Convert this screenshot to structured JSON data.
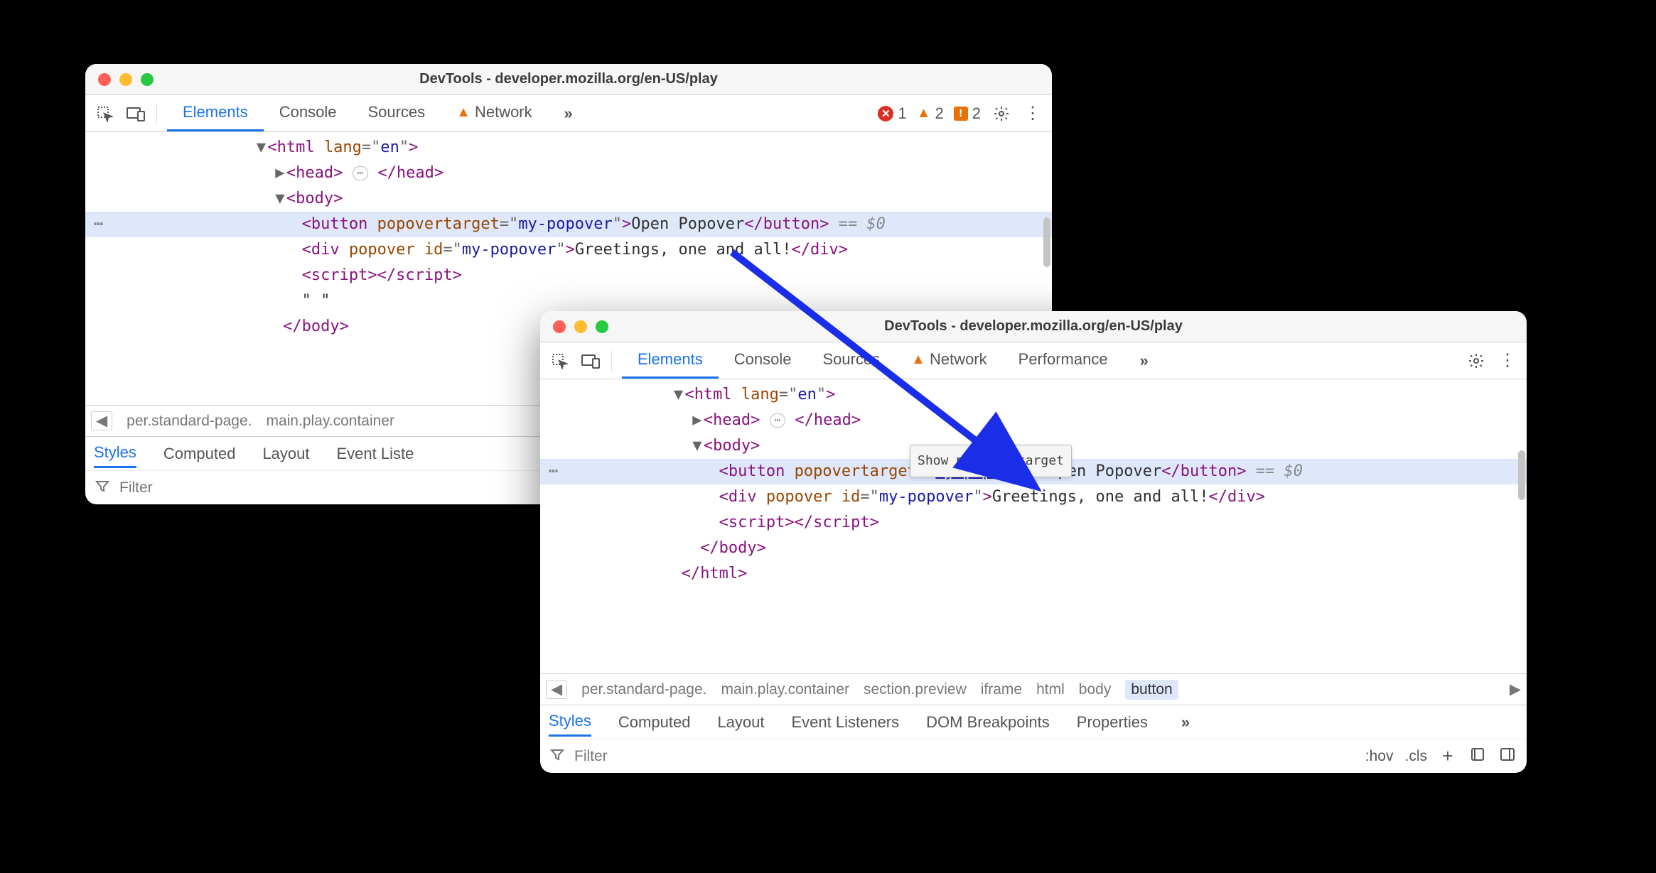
{
  "window1": {
    "title": "DevTools - developer.mozilla.org/en-US/play",
    "tabs": [
      "Elements",
      "Console",
      "Sources",
      "Network"
    ],
    "active_tab": "Elements",
    "network_has_warning": true,
    "counts": {
      "errors": "1",
      "warnings": "2",
      "issues": "2"
    },
    "dom": {
      "html_open": "<html lang=\"en\">",
      "head": {
        "open": "<head>",
        "close": "</head>"
      },
      "body_open": "<body>",
      "button": {
        "tag_open": "<button",
        "attr_name": "popovertarget",
        "attr_val": "my-popover",
        "text": "Open Popover",
        "tag_close": "</button>",
        "eq": " == $0"
      },
      "div": {
        "tag_open": "<div",
        "attr1": "popover",
        "attr2_name": "id",
        "attr2_val": "my-popover",
        "text": "Greetings, one and all!",
        "tag_close": "</div>"
      },
      "script": {
        "open": "<script>",
        "close": "</script>"
      },
      "quote_row": "\" \"",
      "body_close": "</body>"
    },
    "crumbs": [
      "per.standard-page.",
      "main.play.container"
    ],
    "subtabs": [
      "Styles",
      "Computed",
      "Layout",
      "Event Liste"
    ],
    "active_subtab": "Styles",
    "filter_placeholder": "Filter"
  },
  "window2": {
    "title": "DevTools - developer.mozilla.org/en-US/play",
    "tabs": [
      "Elements",
      "Console",
      "Sources",
      "Network",
      "Performance"
    ],
    "active_tab": "Elements",
    "network_has_warning": true,
    "dom": {
      "html_open": "<html lang=\"en\">",
      "head": {
        "open": "<head>",
        "close": "</head>"
      },
      "body_open": "<body>",
      "button": {
        "tag_open": "<button",
        "attr_name": "popovertarget",
        "attr_val": "my-popover",
        "text": "Open Popover",
        "tag_close": "</button>",
        "eq": " == $0"
      },
      "div": {
        "tag_open": "<div",
        "attr1": "popover",
        "attr2_name": "id",
        "attr2_val": "my-popover",
        "text": "Greetings, one and all!",
        "tag_close": "</div>"
      },
      "script": {
        "open": "<script>",
        "close": "</script>"
      },
      "body_close": "</body>",
      "html_close": "</html>"
    },
    "tooltip": "Show popover target",
    "crumbs": [
      "per.standard-page.",
      "main.play.container",
      "section.preview",
      "iframe",
      "html",
      "body",
      "button"
    ],
    "selected_crumb": "button",
    "subtabs": [
      "Styles",
      "Computed",
      "Layout",
      "Event Listeners",
      "DOM Breakpoints",
      "Properties"
    ],
    "active_subtab": "Styles",
    "filter_placeholder": "Filter",
    "filter_right": {
      "hov": ":hov",
      "cls": ".cls"
    }
  }
}
